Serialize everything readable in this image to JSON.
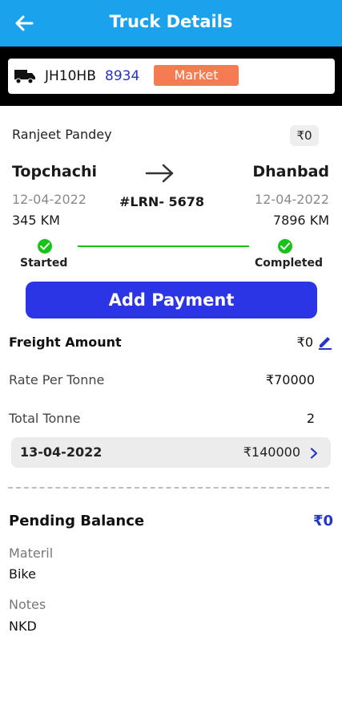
{
  "header": {
    "title": "Truck Details"
  },
  "truck": {
    "number_prefix": "JH10HB",
    "number_suffix": "8934",
    "tag": "Market"
  },
  "trip": {
    "driver": "Ranjeet Pandey",
    "amount": "₹0",
    "from_city": "Topchachi",
    "to_city": "Dhanbad",
    "from_date": "12-04-2022",
    "to_date": "12-04-2022",
    "lrn": "#LRN- 5678",
    "from_km": "345 KM",
    "to_km": "7896 KM",
    "status_start": "Started",
    "status_end": "Completed",
    "progress": 1.0
  },
  "actions": {
    "add_payment": "Add Payment"
  },
  "freight": {
    "freight_label": "Freight Amount",
    "freight_value": "₹0",
    "rate_label": "Rate Per Tonne",
    "rate_value": "₹70000",
    "tonne_label": "Total Tonne",
    "tonne_value": "2"
  },
  "payment_row": {
    "date": "13-04-2022",
    "amount": "₹140000"
  },
  "balance": {
    "label": "Pending Balance",
    "value": "₹0"
  },
  "material": {
    "label": "Materil",
    "value": "Bike"
  },
  "notes": {
    "label": "Notes",
    "value": "NKD"
  },
  "colors": {
    "appbar": "#1aa3ec",
    "primary_button": "#2b35e6",
    "tag": "#f47b52",
    "status_green": "#17c317",
    "accent_blue": "#2434c8"
  },
  "icons": {
    "back": "back-arrow-icon",
    "truck": "truck-icon",
    "route": "right-arrow-icon",
    "check": "check-circle-icon",
    "edit": "pencil-icon",
    "chevron": "chevron-right-icon"
  }
}
